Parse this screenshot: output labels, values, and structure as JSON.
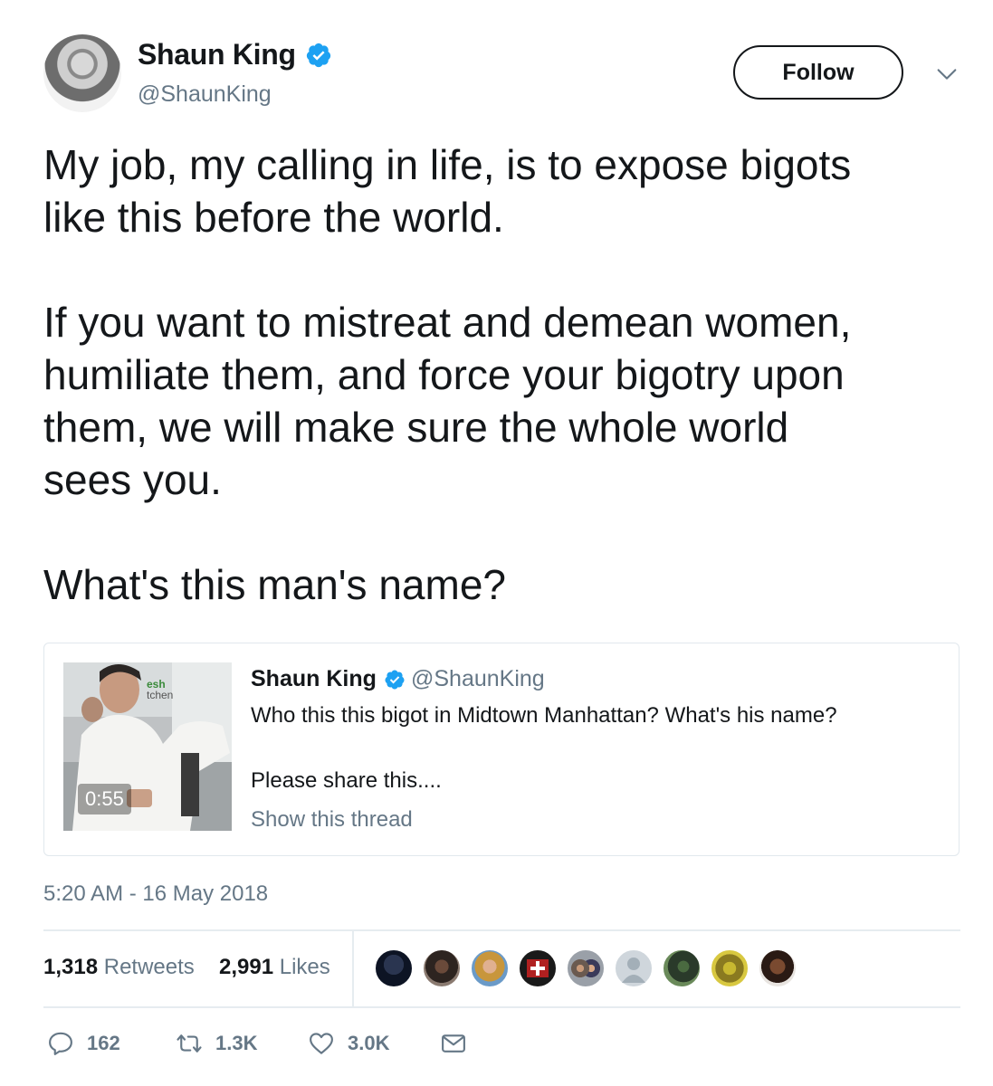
{
  "author": {
    "name": "Shaun King",
    "handle": "@ShaunKing",
    "verified": true
  },
  "header": {
    "follow_label": "Follow"
  },
  "tweet": {
    "lines": [
      "My job, my calling in life, is to expose bigots",
      "like this before the world.",
      "If you want to mistreat and demean women,",
      "humiliate them, and force your bigotry upon",
      "them, we will make sure the whole world",
      "sees you.",
      "What's this man's name?"
    ]
  },
  "quote": {
    "name": "Shaun King",
    "handle": "@ShaunKing",
    "text_1": "Who this this bigot in Midtown Manhattan? What's his name?",
    "text_2": "Please share this....",
    "thread_link": "Show this thread",
    "video_duration": "0:55",
    "thumb_sign_text": "esh\ntchen"
  },
  "timestamp": "5:20 AM - 16 May 2018",
  "stats": {
    "retweets_count": "1,318",
    "retweets_label": "Retweets",
    "likes_count": "2,991",
    "likes_label": "Likes"
  },
  "actions": {
    "replies": "162",
    "retweets": "1.3K",
    "likes": "3.0K"
  },
  "colors": {
    "text": "#14171a",
    "muted": "#657786",
    "verified": "#1da1f2",
    "border": "#e1e8ed"
  }
}
